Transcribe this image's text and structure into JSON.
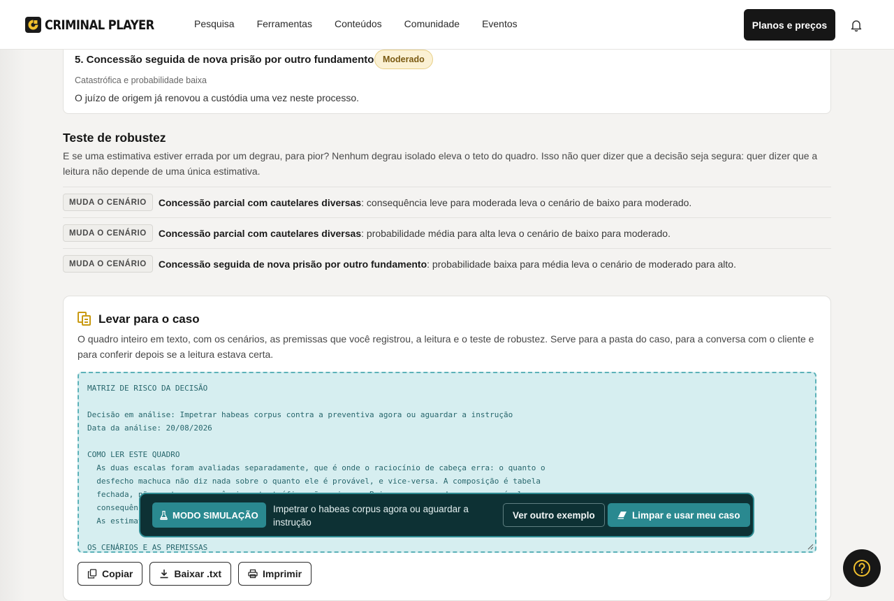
{
  "header": {
    "brand": "CRIMINAL PLAYER",
    "nav": [
      "Pesquisa",
      "Ferramentas",
      "Conteúdos",
      "Comunidade",
      "Eventos"
    ],
    "plans_label": "Planos e preços"
  },
  "scenario": {
    "title": "5. Concessão seguida de nova prisão por outro fundamento",
    "badge": "Moderado",
    "subtitle": "Catastrófica e probabilidade baixa",
    "description": "O juízo de origem já renovou a custódia uma vez neste processo."
  },
  "robustness": {
    "title": "Teste de robustez",
    "text": "E se uma estimativa estiver errada por um degrau, para pior? Nenhum degrau isolado eleva o teto do quadro. Isso não quer dizer que a decisão seja segura: quer dizer que a leitura não depende de uma única estimativa.",
    "items": [
      {
        "tag": "MUDA O CENÁRIO",
        "bold": "Concessão parcial com cautelares diversas",
        "rest": ": consequência leve para moderada leva o cenário de baixo para moderado."
      },
      {
        "tag": "MUDA O CENÁRIO",
        "bold": "Concessão parcial com cautelares diversas",
        "rest": ": probabilidade média para alta leva o cenário de baixo para moderado."
      },
      {
        "tag": "MUDA O CENÁRIO",
        "bold": "Concessão seguida de nova prisão por outro fundamento",
        "rest": ": probabilidade baixa para média leva o cenário de moderado para alto."
      }
    ]
  },
  "case": {
    "title": "Levar para o caso",
    "description": "O quadro inteiro em texto, com os cenários, as premissas que você registrou, a leitura e o teste de robustez. Serve para a pasta do caso, para a conversa com o cliente e para conferir depois se a leitura estava certa.",
    "export_text": "MATRIZ DE RISCO DA DECISÃO\n\nDecisão em análise: Impetrar habeas corpus contra a preventiva agora ou aguardar a instrução\nData da análise: 20/08/2026\n\nCOMO LER ESTE QUADRO\n  As duas escalas foram avaliadas separadamente, que é onde o raciocínio de cabeça erra: o quanto o\n  desfecho machuca não diz nada sobre o quanto ele é provável, e vice-versa. A composição é tabela\n  fechada, não conta: consequência catastrófica não cai para Baixo mesmo quando pouco provável, e\n  consequência leve não sobe para Alto mesmo quando muito provável.\n  As estimativas são suas; o quadro só organiza o que você registrou.\n\nOS CENÁRIOS E AS PREMISSAS",
    "copy_label": "Copiar",
    "download_label": "Baixar .txt",
    "print_label": "Imprimir"
  },
  "simulation": {
    "badge": "MODO SIMULAÇÃO",
    "text": "Impetrar o habeas corpus agora ou aguardar a instrução",
    "other_example_label": "Ver outro exemplo",
    "clear_label": "Limpar e usar meu caso"
  },
  "colors": {
    "accent_teal": "#2a8990",
    "banner_bg": "#0d3134",
    "badge_moderate_bg": "#fbf1d4",
    "logo_yellow": "#f2c12e"
  }
}
